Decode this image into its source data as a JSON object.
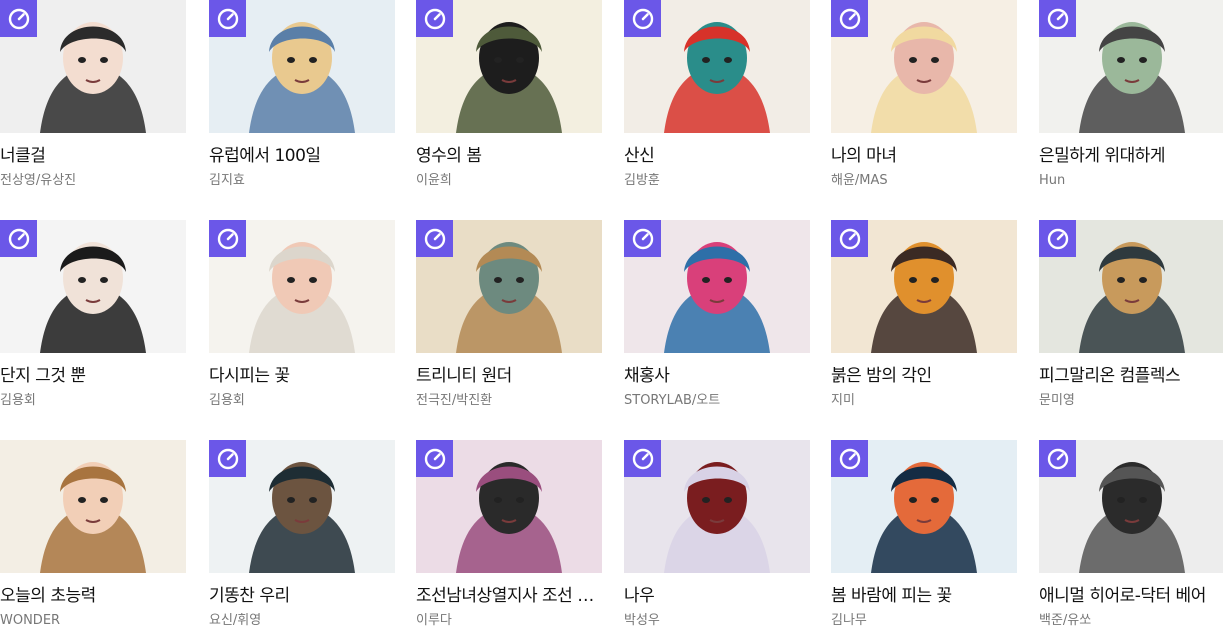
{
  "badge_icon": "clock-badge-icon",
  "badge_color": "#6b57e8",
  "webtoons": [
    {
      "title": "너클걸",
      "author": "전상영/유상진",
      "badge": true,
      "palette": [
        "#efefef",
        "#2b2b2b",
        "#f3ddd0"
      ]
    },
    {
      "title": "유럽에서 100일",
      "author": "김지효",
      "badge": true,
      "palette": [
        "#e6eef3",
        "#5a7fa8",
        "#e9c98f"
      ]
    },
    {
      "title": "영수의 봄",
      "author": "이윤희",
      "badge": true,
      "palette": [
        "#f3efe0",
        "#4e5a3a",
        "#1d1d1d"
      ]
    },
    {
      "title": "산신",
      "author": "김방훈",
      "badge": true,
      "palette": [
        "#f2ede6",
        "#d7322a",
        "#2a8d8a"
      ]
    },
    {
      "title": "나의 마녀",
      "author": "해윤/MAS",
      "badge": true,
      "palette": [
        "#f6efe4",
        "#f1d9a0",
        "#e8b7aa"
      ]
    },
    {
      "title": "은밀하게 위대하게",
      "author": "Hun",
      "badge": true,
      "palette": [
        "#f1f1ee",
        "#444444",
        "#9bb89a"
      ]
    },
    {
      "title": "단지 그것 뿐",
      "author": "김용회",
      "badge": true,
      "palette": [
        "#f4f4f4",
        "#1b1b1b",
        "#f0e2d8"
      ]
    },
    {
      "title": "다시피는 꽃",
      "author": "김용회",
      "badge": true,
      "palette": [
        "#f5f3ee",
        "#dcd6cc",
        "#f0c9b6"
      ]
    },
    {
      "title": "트리니티 원더",
      "author": "전극진/박진환",
      "badge": true,
      "palette": [
        "#e9ddc6",
        "#b38a55",
        "#6d8a7f"
      ]
    },
    {
      "title": "채홍사",
      "author": "STORYLAB/오트",
      "badge": true,
      "palette": [
        "#efe6ea",
        "#2e6fa8",
        "#d9407a"
      ]
    },
    {
      "title": "붉은 밤의 각인",
      "author": "지미",
      "badge": true,
      "palette": [
        "#f2e6d3",
        "#3b2a24",
        "#e0902d"
      ]
    },
    {
      "title": "피그말리온 컴플렉스",
      "author": "문미영",
      "badge": true,
      "palette": [
        "#e4e6df",
        "#2f3a3e",
        "#c89a5c"
      ]
    },
    {
      "title": "오늘의 초능력",
      "author": "WONDER",
      "badge": false,
      "palette": [
        "#f3eee4",
        "#a8743f",
        "#f2cfb7"
      ]
    },
    {
      "title": "기똥찬 우리",
      "author": "요신/휘영",
      "badge": true,
      "palette": [
        "#eef2f3",
        "#1e2d34",
        "#6c5440"
      ]
    },
    {
      "title": "조선남녀상열지사 조선 마녀",
      "author": "이루다",
      "badge": true,
      "palette": [
        "#ecdce6",
        "#9a4e7e",
        "#2a2a2a"
      ]
    },
    {
      "title": "나우",
      "author": "박성우",
      "badge": true,
      "palette": [
        "#e8e4ec",
        "#d8d2e6",
        "#7a1d1f"
      ]
    },
    {
      "title": "봄 바람에 피는 꽃",
      "author": "김나무",
      "badge": true,
      "palette": [
        "#e4eef4",
        "#142c44",
        "#e46a3a"
      ]
    },
    {
      "title": "애니멀 히어로-닥터 베어",
      "author": "백준/유쏘",
      "badge": true,
      "palette": [
        "#ededed",
        "#555555",
        "#2b2b2b"
      ]
    }
  ]
}
